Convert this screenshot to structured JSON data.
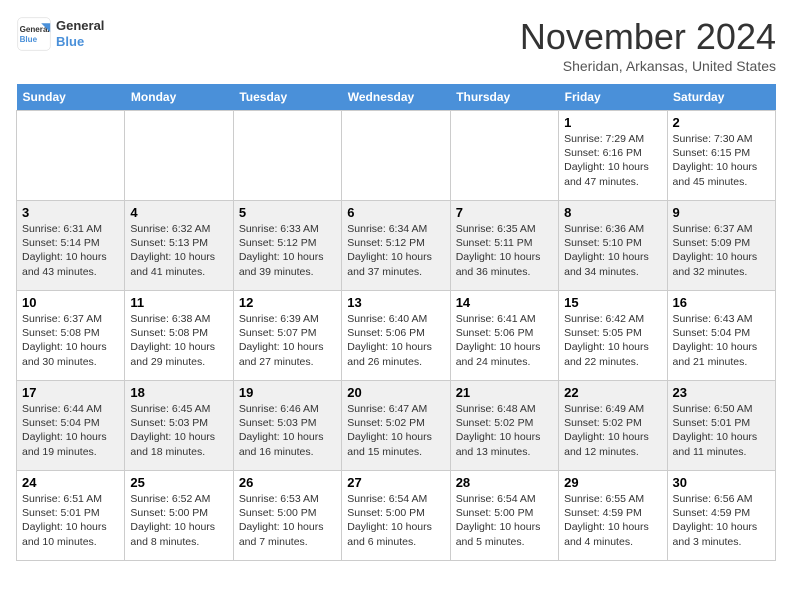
{
  "header": {
    "logo_line1": "General",
    "logo_line2": "Blue",
    "month": "November 2024",
    "location": "Sheridan, Arkansas, United States"
  },
  "days_of_week": [
    "Sunday",
    "Monday",
    "Tuesday",
    "Wednesday",
    "Thursday",
    "Friday",
    "Saturday"
  ],
  "weeks": [
    [
      {
        "day": "",
        "info": ""
      },
      {
        "day": "",
        "info": ""
      },
      {
        "day": "",
        "info": ""
      },
      {
        "day": "",
        "info": ""
      },
      {
        "day": "",
        "info": ""
      },
      {
        "day": "1",
        "info": "Sunrise: 7:29 AM\nSunset: 6:16 PM\nDaylight: 10 hours and 47 minutes."
      },
      {
        "day": "2",
        "info": "Sunrise: 7:30 AM\nSunset: 6:15 PM\nDaylight: 10 hours and 45 minutes."
      }
    ],
    [
      {
        "day": "3",
        "info": "Sunrise: 6:31 AM\nSunset: 5:14 PM\nDaylight: 10 hours and 43 minutes."
      },
      {
        "day": "4",
        "info": "Sunrise: 6:32 AM\nSunset: 5:13 PM\nDaylight: 10 hours and 41 minutes."
      },
      {
        "day": "5",
        "info": "Sunrise: 6:33 AM\nSunset: 5:12 PM\nDaylight: 10 hours and 39 minutes."
      },
      {
        "day": "6",
        "info": "Sunrise: 6:34 AM\nSunset: 5:12 PM\nDaylight: 10 hours and 37 minutes."
      },
      {
        "day": "7",
        "info": "Sunrise: 6:35 AM\nSunset: 5:11 PM\nDaylight: 10 hours and 36 minutes."
      },
      {
        "day": "8",
        "info": "Sunrise: 6:36 AM\nSunset: 5:10 PM\nDaylight: 10 hours and 34 minutes."
      },
      {
        "day": "9",
        "info": "Sunrise: 6:37 AM\nSunset: 5:09 PM\nDaylight: 10 hours and 32 minutes."
      }
    ],
    [
      {
        "day": "10",
        "info": "Sunrise: 6:37 AM\nSunset: 5:08 PM\nDaylight: 10 hours and 30 minutes."
      },
      {
        "day": "11",
        "info": "Sunrise: 6:38 AM\nSunset: 5:08 PM\nDaylight: 10 hours and 29 minutes."
      },
      {
        "day": "12",
        "info": "Sunrise: 6:39 AM\nSunset: 5:07 PM\nDaylight: 10 hours and 27 minutes."
      },
      {
        "day": "13",
        "info": "Sunrise: 6:40 AM\nSunset: 5:06 PM\nDaylight: 10 hours and 26 minutes."
      },
      {
        "day": "14",
        "info": "Sunrise: 6:41 AM\nSunset: 5:06 PM\nDaylight: 10 hours and 24 minutes."
      },
      {
        "day": "15",
        "info": "Sunrise: 6:42 AM\nSunset: 5:05 PM\nDaylight: 10 hours and 22 minutes."
      },
      {
        "day": "16",
        "info": "Sunrise: 6:43 AM\nSunset: 5:04 PM\nDaylight: 10 hours and 21 minutes."
      }
    ],
    [
      {
        "day": "17",
        "info": "Sunrise: 6:44 AM\nSunset: 5:04 PM\nDaylight: 10 hours and 19 minutes."
      },
      {
        "day": "18",
        "info": "Sunrise: 6:45 AM\nSunset: 5:03 PM\nDaylight: 10 hours and 18 minutes."
      },
      {
        "day": "19",
        "info": "Sunrise: 6:46 AM\nSunset: 5:03 PM\nDaylight: 10 hours and 16 minutes."
      },
      {
        "day": "20",
        "info": "Sunrise: 6:47 AM\nSunset: 5:02 PM\nDaylight: 10 hours and 15 minutes."
      },
      {
        "day": "21",
        "info": "Sunrise: 6:48 AM\nSunset: 5:02 PM\nDaylight: 10 hours and 13 minutes."
      },
      {
        "day": "22",
        "info": "Sunrise: 6:49 AM\nSunset: 5:02 PM\nDaylight: 10 hours and 12 minutes."
      },
      {
        "day": "23",
        "info": "Sunrise: 6:50 AM\nSunset: 5:01 PM\nDaylight: 10 hours and 11 minutes."
      }
    ],
    [
      {
        "day": "24",
        "info": "Sunrise: 6:51 AM\nSunset: 5:01 PM\nDaylight: 10 hours and 10 minutes."
      },
      {
        "day": "25",
        "info": "Sunrise: 6:52 AM\nSunset: 5:00 PM\nDaylight: 10 hours and 8 minutes."
      },
      {
        "day": "26",
        "info": "Sunrise: 6:53 AM\nSunset: 5:00 PM\nDaylight: 10 hours and 7 minutes."
      },
      {
        "day": "27",
        "info": "Sunrise: 6:54 AM\nSunset: 5:00 PM\nDaylight: 10 hours and 6 minutes."
      },
      {
        "day": "28",
        "info": "Sunrise: 6:54 AM\nSunset: 5:00 PM\nDaylight: 10 hours and 5 minutes."
      },
      {
        "day": "29",
        "info": "Sunrise: 6:55 AM\nSunset: 4:59 PM\nDaylight: 10 hours and 4 minutes."
      },
      {
        "day": "30",
        "info": "Sunrise: 6:56 AM\nSunset: 4:59 PM\nDaylight: 10 hours and 3 minutes."
      }
    ]
  ]
}
